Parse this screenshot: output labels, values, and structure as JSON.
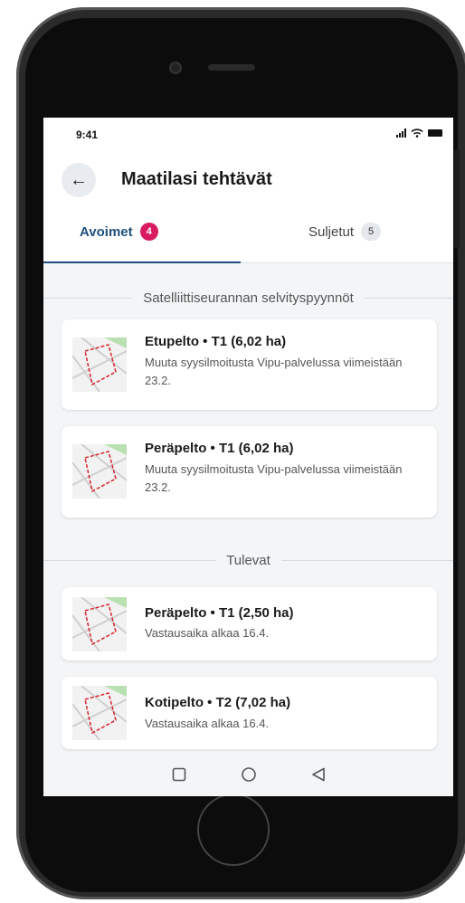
{
  "status": {
    "time": "9:41"
  },
  "header": {
    "back_icon": "arrow-left-icon",
    "title": "Maatilasi tehtävät"
  },
  "tabs": [
    {
      "label": "Avoimet",
      "count": "4"
    },
    {
      "label": "Suljetut",
      "count": "5"
    }
  ],
  "sections": [
    {
      "title": "Satelliittiseurannan selvityspyynnöt",
      "items": [
        {
          "title": "Etupelto • T1 (6,02 ha)",
          "description": "Muuta syysilmoitusta Vipu-palvelussa viimeistään 23.2."
        },
        {
          "title": "Peräpelto • T1 (6,02 ha)",
          "description": "Muuta syysilmoitusta Vipu-palvelussa viimeistään 23.2."
        }
      ]
    },
    {
      "title": "Tulevat",
      "items": [
        {
          "title": "Peräpelto • T1 (2,50 ha)",
          "description": "Vastausaika alkaa 16.4."
        },
        {
          "title": "Kotipelto • T2 (7,02 ha)",
          "description": "Vastausaika alkaa 16.4."
        }
      ]
    }
  ],
  "colors": {
    "accent": "#1f4f7a",
    "badge": "#d81b60"
  }
}
